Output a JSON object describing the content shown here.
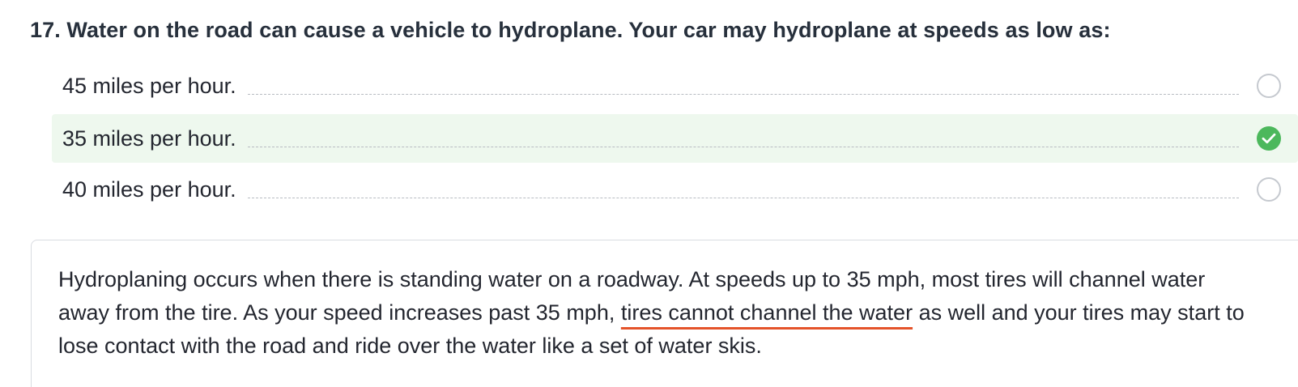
{
  "question": {
    "title": "17. Water on the road can cause a vehicle to hydroplane. Your car may hydroplane at speeds as low as:"
  },
  "answers": [
    {
      "label": "45 miles per hour.",
      "state": "unselected"
    },
    {
      "label": "35 miles per hour.",
      "state": "correct"
    },
    {
      "label": "40 miles per hour.",
      "state": "unselected"
    }
  ],
  "explanation": {
    "before": "Hydroplaning occurs when there is standing water on a roadway. At speeds up to 35 mph, most tires will channel water away from the tire. As your speed increases past 35 mph, ",
    "highlight": "tires cannot channel the water",
    "after": " as well and your tires may start to lose contact with the road and ride over the water like a set of water skis."
  },
  "colors": {
    "correct_bg": "#eef8ee",
    "correct_check": "#4cb85c",
    "highlight_underline": "#e4532a"
  },
  "icons": {
    "checked": "checkmark-circle-icon",
    "unchecked": "empty-circle-icon"
  }
}
